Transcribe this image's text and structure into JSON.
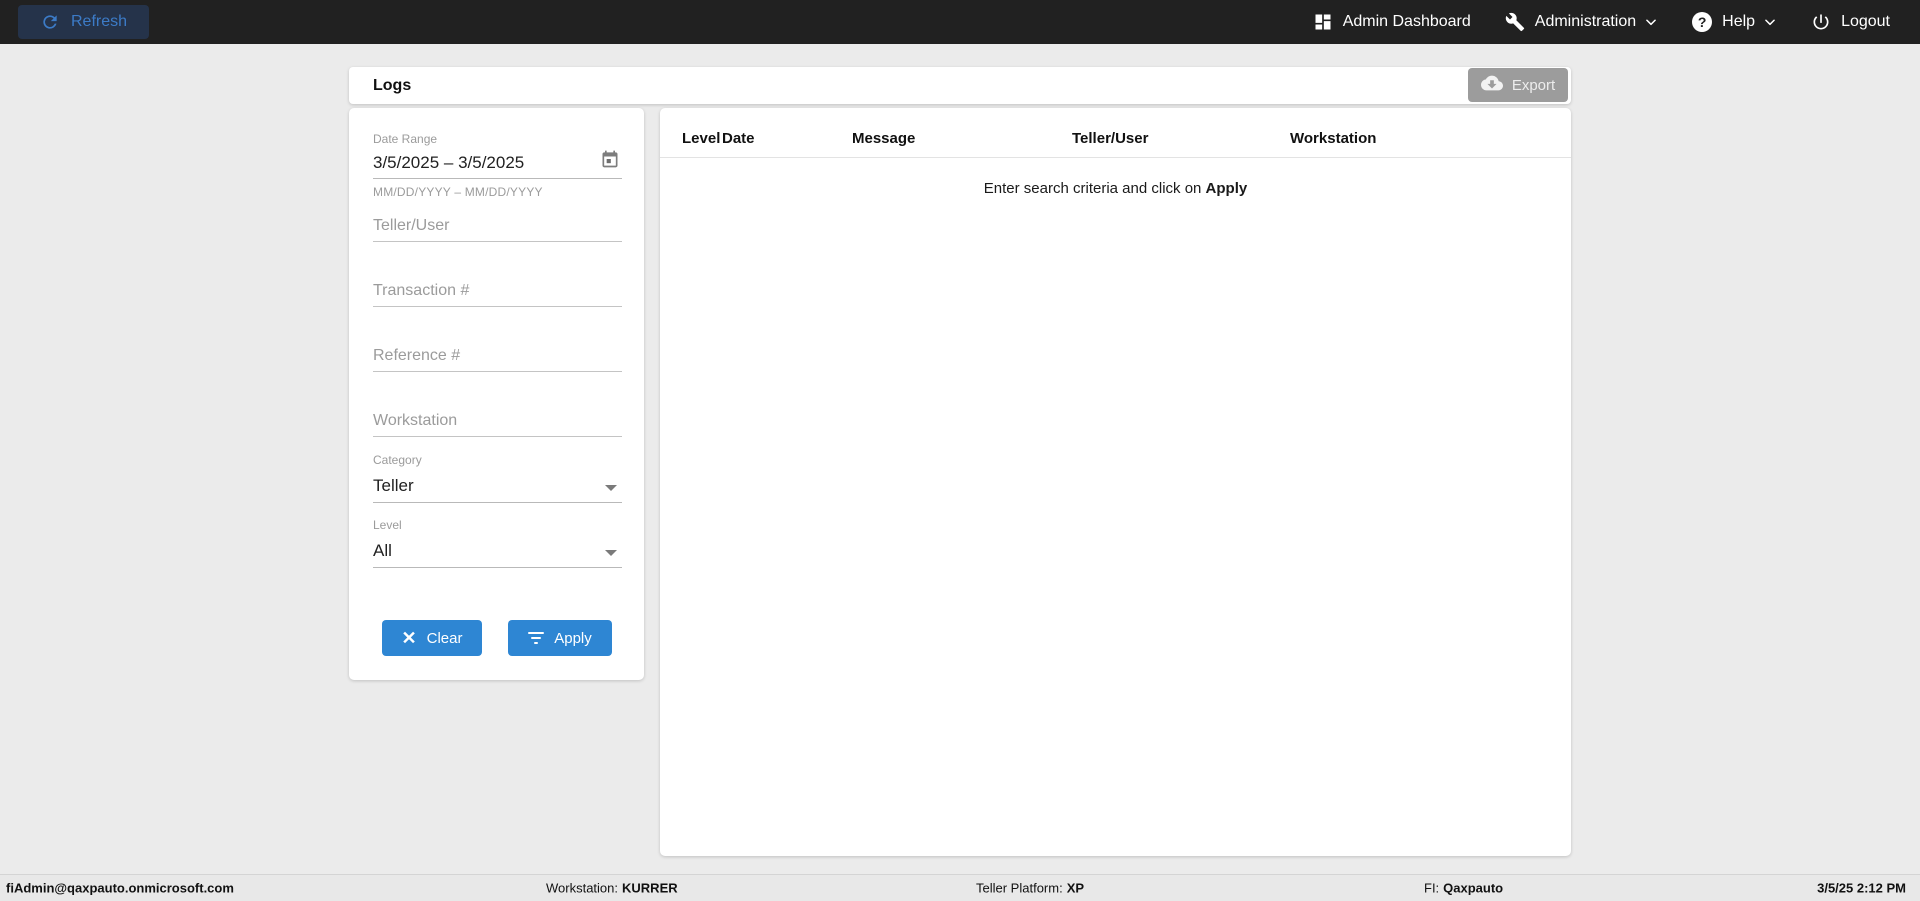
{
  "topbar": {
    "refresh_label": "Refresh",
    "nav": [
      {
        "label": "Admin Dashboard"
      },
      {
        "label": "Administration"
      },
      {
        "label": "Help"
      },
      {
        "label": "Logout"
      }
    ],
    "help_glyph": "?"
  },
  "toolbar": {
    "title": "Logs",
    "export_label": "Export"
  },
  "filters": {
    "date_range": {
      "label": "Date Range",
      "value": "3/5/2025 – 3/5/2025",
      "hint": "MM/DD/YYYY – MM/DD/YYYY"
    },
    "text_fields": [
      {
        "placeholder": "Teller/User"
      },
      {
        "placeholder": "Transaction #"
      },
      {
        "placeholder": "Reference #"
      },
      {
        "placeholder": "Workstation"
      }
    ],
    "selects": [
      {
        "label": "Category",
        "value": "Teller"
      },
      {
        "label": "Level",
        "value": "All"
      }
    ],
    "clear_label": "Clear",
    "apply_label": "Apply"
  },
  "table": {
    "columns": [
      "Level",
      "Date",
      "Message",
      "Teller/User",
      "Workstation"
    ],
    "empty_message_prefix": "Enter search criteria and click on ",
    "empty_message_bold": "Apply"
  },
  "statusbar": {
    "user": "fiAdmin@qaxpauto.onmicrosoft.com",
    "workstation_label": "Workstation:",
    "workstation_value": "KURRER",
    "platform_label": "Teller Platform:",
    "platform_value": "XP",
    "fi_label": "FI:",
    "fi_value": "Qaxpauto",
    "datetime": "3/5/25 2:12 PM"
  },
  "colors": {
    "topbar_bg": "#212121",
    "accent_blue": "#2e86d3",
    "refresh_blue": "#3c7bc7",
    "disabled_gray": "#9c9c9c",
    "page_bg": "#ebebeb"
  }
}
